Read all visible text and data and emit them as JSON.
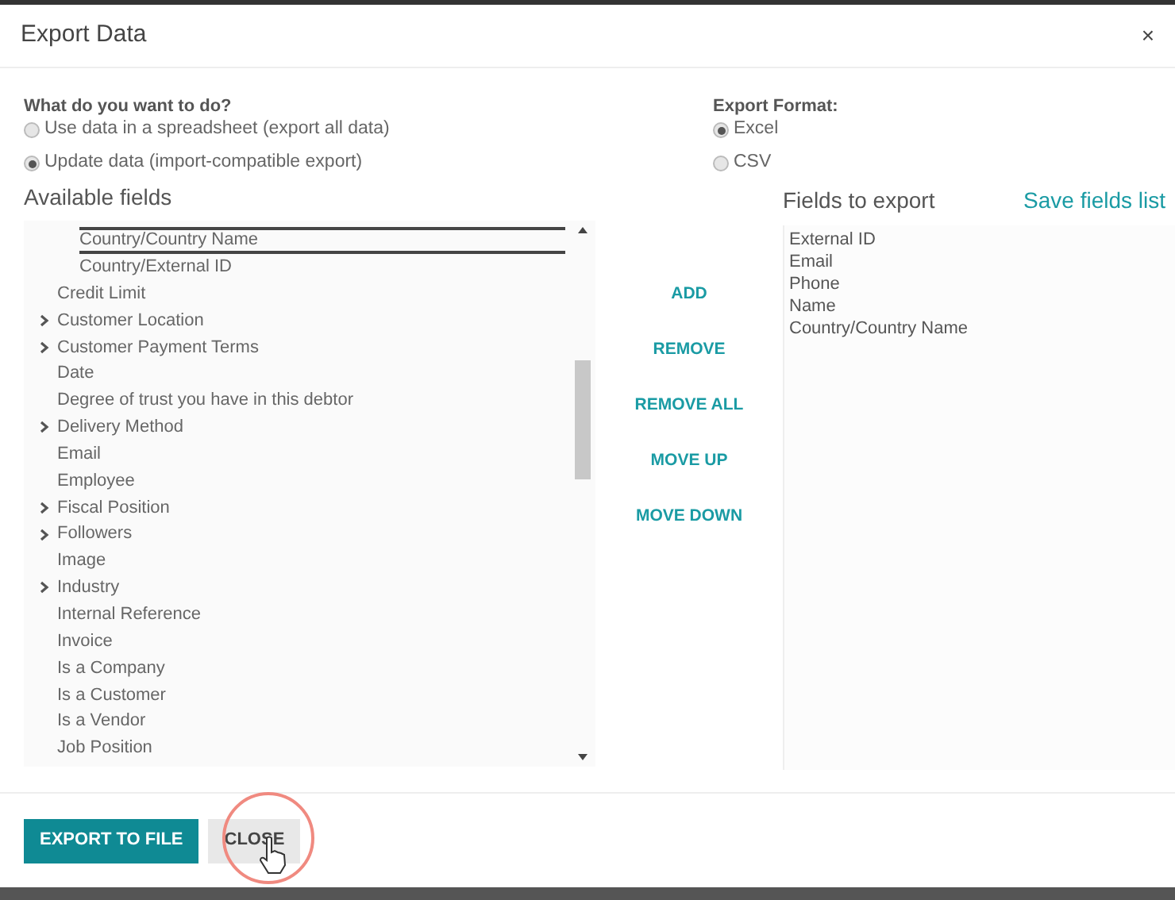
{
  "dialog": {
    "title": "Export Data",
    "close": "×"
  },
  "question": {
    "label": "What do you want to do?",
    "options": [
      {
        "label": "Use data in a spreadsheet (export all data)",
        "selected": false
      },
      {
        "label": "Update data (import-compatible export)",
        "selected": true
      }
    ]
  },
  "format": {
    "label": "Export Format:",
    "options": [
      {
        "label": "Excel",
        "selected": true
      },
      {
        "label": "CSV",
        "selected": false
      }
    ]
  },
  "available": {
    "title": "Available fields",
    "fields": [
      {
        "children": [
          {
            "label": "Country/Country Name",
            "selected": true,
            "expandable": false
          },
          {
            "label": "Country/External ID",
            "selected": false,
            "expandable": false
          }
        ]
      },
      {
        "label": "Credit Limit",
        "selected": false,
        "expandable": false
      },
      {
        "label": "Customer Location",
        "selected": false,
        "expandable": true
      },
      {
        "label": "Customer Payment Terms",
        "selected": false,
        "expandable": true
      },
      {
        "label": "Date",
        "selected": false,
        "expandable": false
      },
      {
        "label": "Degree of trust you have in this debtor",
        "selected": false,
        "expandable": false
      },
      {
        "label": "Delivery Method",
        "selected": false,
        "expandable": true
      },
      {
        "label": "Email",
        "selected": false,
        "expandable": false
      },
      {
        "label": "Employee",
        "selected": false,
        "expandable": false
      },
      {
        "label": "Fiscal Position",
        "selected": false,
        "expandable": true
      },
      {
        "label": "Followers",
        "selected": false,
        "expandable": true
      },
      {
        "label": "Image",
        "selected": false,
        "expandable": false
      },
      {
        "label": "Industry",
        "selected": false,
        "expandable": true
      },
      {
        "label": "Internal Reference",
        "selected": false,
        "expandable": false
      },
      {
        "label": "Invoice",
        "selected": false,
        "expandable": false
      },
      {
        "label": "Is a Company",
        "selected": false,
        "expandable": false
      },
      {
        "label": "Is a Customer",
        "selected": false,
        "expandable": false
      },
      {
        "label": "Is a Vendor",
        "selected": false,
        "expandable": false
      },
      {
        "label": "Job Position",
        "selected": false,
        "expandable": false
      }
    ]
  },
  "actions": [
    "ADD",
    "REMOVE",
    "REMOVE ALL",
    "MOVE UP",
    "MOVE DOWN"
  ],
  "export": {
    "title": "Fields to export",
    "save_link": "Save fields list",
    "fields": [
      "External ID",
      "Email",
      "Phone",
      "Name",
      "Country/Country Name"
    ]
  },
  "footer": {
    "buttons": [
      {
        "label": "EXPORT TO FILE",
        "kind": "primary"
      },
      {
        "label": "CLOSE",
        "kind": "secondary"
      }
    ]
  }
}
